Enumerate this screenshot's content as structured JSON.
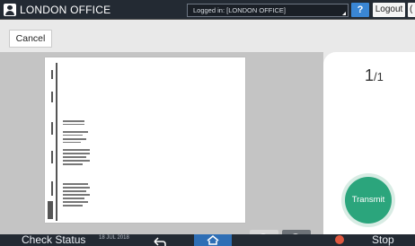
{
  "header": {
    "user_label": "LONDON OFFICE",
    "login_status": "Logged in: [LONDON OFFICE]",
    "help_label": "?",
    "logout_label": "Logout",
    "cut_label": "("
  },
  "toolbar": {
    "cancel_label": "Cancel"
  },
  "preview": {
    "page_current": "1",
    "page_total": "/1"
  },
  "actions": {
    "transmit_label": "Transmit"
  },
  "footer": {
    "check_status_label": "Check Status",
    "date_text": "18 JUL 2018",
    "stop_label": "Stop"
  },
  "colors": {
    "topbar": "#232a33",
    "help": "#3a86d4",
    "transmit": "#2ba57c",
    "home": "#2e6eb5",
    "stop": "#e0583f"
  }
}
